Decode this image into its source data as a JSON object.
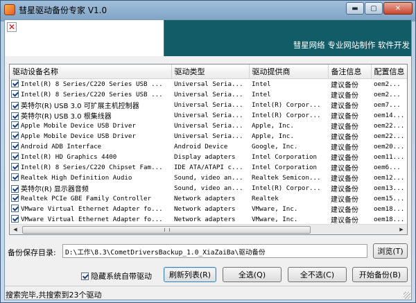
{
  "window": {
    "title": "彗星驱动备份专家 V1.0",
    "minimize_glyph": "▬",
    "maximize_glyph": "▢",
    "close_glyph": "✕"
  },
  "banner": {
    "close_glyph": "✕",
    "text": "彗星网络  专业网站制作  软件开发"
  },
  "grid": {
    "columns": [
      "驱动设备名称",
      "驱动类型",
      "驱动提供商",
      "备注信息",
      "配置信息"
    ],
    "rows": [
      {
        "name": "Intel(R) 8 Series/C220 Series USB ...",
        "type": "Universal Seria...",
        "provider": "Intel",
        "note": "建议备份",
        "inf": "oem2..."
      },
      {
        "name": "Intel(R) 8 Series/C220 Series USB ...",
        "type": "Universal Seria...",
        "provider": "Intel",
        "note": "建议备份",
        "inf": "oem2..."
      },
      {
        "name": "英特尔(R) USB 3.0 可扩展主机控制器",
        "type": "Universal Seria...",
        "provider": "Intel(R) Corpor...",
        "note": "建议备份",
        "inf": "oem7..."
      },
      {
        "name": "英特尔(R) USB 3.0 根集线器",
        "type": "Universal Seria...",
        "provider": "Intel(R) Corpor...",
        "note": "建议备份",
        "inf": "oem14..."
      },
      {
        "name": "Apple Mobile Device USB Driver",
        "type": "Universal Seria...",
        "provider": "Apple, Inc.",
        "note": "建议备份",
        "inf": "oem22..."
      },
      {
        "name": "Apple Mobile Device USB Driver",
        "type": "Universal Seria...",
        "provider": "Apple, Inc.",
        "note": "建议备份",
        "inf": "oem22..."
      },
      {
        "name": "Android ADB Interface",
        "type": "Android Device",
        "provider": "Google, Inc.",
        "note": "建议备份",
        "inf": "oem20..."
      },
      {
        "name": "Intel(R) HD Graphics 4400",
        "type": "Display adapters",
        "provider": "Intel Corporation",
        "note": "建议备份",
        "inf": "oem11..."
      },
      {
        "name": "Intel(R) 8 Series/C220 Chipset Fam...",
        "type": "IDE ATA/ATAPI c...",
        "provider": "Intel Corporation",
        "note": "建议备份",
        "inf": "oem6..."
      },
      {
        "name": "Realtek High Definition Audio",
        "type": "Sound, video an...",
        "provider": "Realtek Semicon...",
        "note": "建议备份",
        "inf": "oem12..."
      },
      {
        "name": "英特尔(R) 显示器音频",
        "type": "Sound, video an...",
        "provider": "Intel(R) Corpor...",
        "note": "建议备份",
        "inf": "oem13..."
      },
      {
        "name": "Realtek PCIe GBE Family Controller",
        "type": "Network adapters",
        "provider": "Realtek",
        "note": "建议备份",
        "inf": "oem15..."
      },
      {
        "name": "VMware Virtual Ethernet Adapter fo...",
        "type": "Network adapters",
        "provider": "VMware, Inc.",
        "note": "建议备份",
        "inf": "oem18..."
      },
      {
        "name": "VMware Virtual Ethernet Adapter fo...",
        "type": "Network adapters",
        "provider": "VMware, Inc.",
        "note": "建议备份",
        "inf": "oem18..."
      }
    ],
    "scroll_left_glyph": "◀",
    "scroll_right_glyph": "▶"
  },
  "backup": {
    "path_label": "备份保存目录:",
    "path_value": "D:\\工作\\8.3\\CometDriversBackup_1.0_XiaZaiBa\\驱动备份",
    "browse_label": "浏览(T)"
  },
  "actions": {
    "hide_system_label": "隐藏系统自带驱动",
    "hide_system_checked": true,
    "refresh_label": "刷新列表(R)",
    "select_all_label": "全选(Q)",
    "select_none_label": "全不选(C)",
    "start_label": "开始备份(B)"
  },
  "status": {
    "text": "搜索完毕,共搜索到23个驱动"
  }
}
